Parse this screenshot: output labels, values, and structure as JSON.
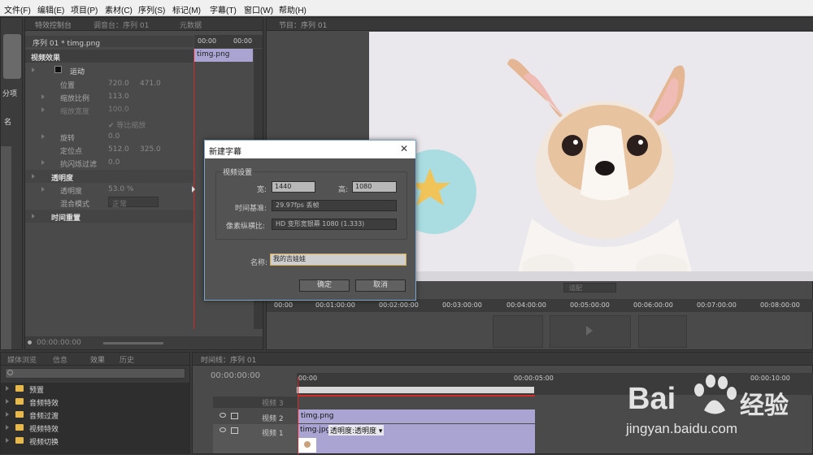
{
  "menu": [
    "文件(F)",
    "编辑(E)",
    "项目(P)",
    "素材(C)",
    "序列(S)",
    "标记(M)",
    "字幕(T)",
    "窗口(W)",
    "帮助(H)"
  ],
  "left_strip": {
    "label1": "分项",
    "label2": "名"
  },
  "effect_controls": {
    "tabs": [
      "特效控制台",
      "调音台：序列 01",
      "元数据"
    ],
    "header": "序列 01 * timg.png",
    "time_start": "00:00",
    "time_end": "00:00",
    "clip_label": "timg.png",
    "video_effects": "视频效果",
    "motion": "运动",
    "position_label": "位置",
    "position_x": "720.0",
    "position_y": "471.0",
    "scale_label": "缩放比例",
    "scale_val": "113.0",
    "scale_width_label": "缩放宽度",
    "scale_width_val": "100.0",
    "uniform_scale": "✔ 等比缩放",
    "rotation_label": "旋转",
    "rotation_val": "0.0",
    "anchor_label": "定位点",
    "anchor_x": "512.0",
    "anchor_y": "325.0",
    "antiflicker_label": "抗闪烁过滤",
    "antiflicker_val": "0.0",
    "opacity_section": "透明度",
    "opacity_label": "透明度",
    "opacity_val": "53.0 %",
    "blend_label": "混合模式",
    "blend_val": "正常",
    "time_remap": "时间重置",
    "footer_time": "00:00:00:00"
  },
  "program": {
    "tab": "节目：序列 01",
    "fit": "适配",
    "ruler": [
      "00:00",
      "00:01:00:00",
      "00:02:00:00",
      "00:03:00:00",
      "00:04:00:00",
      "00:05:00:00",
      "00:06:00:00",
      "00:07:00:00",
      "00:08:00:00"
    ]
  },
  "dialog": {
    "title": "新建字幕",
    "group": "视频设置",
    "width_label": "宽:",
    "width_val": "1440",
    "height_label": "高:",
    "height_val": "1080",
    "timebase_label": "时间基准:",
    "timebase_val": "29.97fps 丢帧",
    "par_label": "像素纵横比:",
    "par_val": "HD 变形宽银幕 1080 (1.333)",
    "name_label": "名称:",
    "name_val": "我的吉娃娃",
    "ok": "确定",
    "cancel": "取消",
    "close": "✕"
  },
  "effects_panel": {
    "tabs": [
      "媒体浏览",
      "信息",
      "效果",
      "历史"
    ],
    "folders": [
      "预置",
      "音频特效",
      "音频过渡",
      "视频特效",
      "视频切换"
    ]
  },
  "timeline": {
    "tab": "时间线：序列 01",
    "timecode": "00:00:00:00",
    "ruler": [
      "00:00",
      "00:00:05:00",
      "00:00:10:00"
    ],
    "track3": "视频 3",
    "track2": "视频 2",
    "track1": "视频 1",
    "clip_v2": "timg.png",
    "clip_v1": "timg.jpg",
    "clip_v1_fx": "透明度:透明度 ▾"
  },
  "watermark": {
    "brand": "Bai",
    "brand2": "经验",
    "url": "jingyan.baidu.com"
  },
  "colors": {
    "accent_red": "#d42a2a",
    "clip_purple": "#a9a4d2",
    "dialog_border": "#7ba3cc"
  }
}
